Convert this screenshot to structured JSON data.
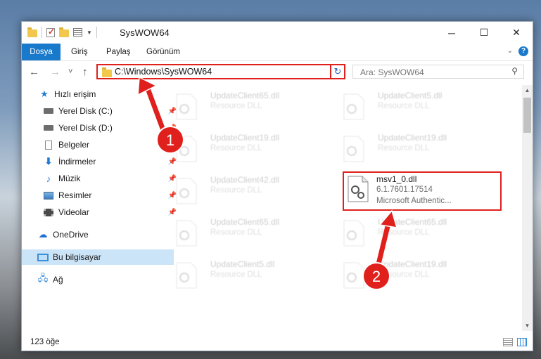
{
  "window": {
    "title": "SysWOW64",
    "controls": {
      "minimize": "─",
      "maximize": "☐",
      "close": "✕"
    }
  },
  "ribbon": {
    "tabs": [
      "Dosya",
      "Giriş",
      "Paylaş",
      "Görünüm"
    ],
    "help": "?"
  },
  "address": {
    "path": "C:\\Windows\\SysWOW64",
    "search_placeholder": "Ara: SysWOW64",
    "back": "←",
    "forward": "→",
    "recent": "˅",
    "up": "↑",
    "refresh": "↻",
    "dropdown": "˅"
  },
  "sidebar": {
    "items": [
      {
        "label": "Hızlı erişim",
        "icon": "star-icon"
      },
      {
        "label": "Yerel Disk (C:)",
        "icon": "drive-icon",
        "pinned": true
      },
      {
        "label": "Yerel Disk (D:)",
        "icon": "drive-icon",
        "pinned": true
      },
      {
        "label": "Belgeler",
        "icon": "documents-icon",
        "pinned": true
      },
      {
        "label": "İndirmeler",
        "icon": "downloads-icon",
        "pinned": true
      },
      {
        "label": "Müzik",
        "icon": "music-icon",
        "pinned": true
      },
      {
        "label": "Resimler",
        "icon": "pictures-icon",
        "pinned": true
      },
      {
        "label": "Videolar",
        "icon": "videos-icon",
        "pinned": true
      },
      {
        "label": "OneDrive",
        "icon": "cloud-icon"
      },
      {
        "label": "Bu bilgisayar",
        "icon": "computer-icon",
        "selected": true
      },
      {
        "label": "Ağ",
        "icon": "network-icon"
      }
    ]
  },
  "files": [
    {
      "name": "UpdateClient65.dll",
      "detail": "Resource DLL"
    },
    {
      "name": "UpdateClient5.dll",
      "detail": "Resource DLL"
    },
    {
      "name": "UpdateClient19.dll",
      "detail": "Resource DLL"
    },
    {
      "name": "UpdateClient19.dll",
      "detail": "Resource DLL"
    },
    {
      "name": "UpdateClient42.dll",
      "detail": "Resource DLL"
    },
    {
      "name": "msv1_0.dll",
      "version": "6.1.7601.17514",
      "detail": "Microsoft Authentic...",
      "highlighted": true
    },
    {
      "name": "UpdateClient65.dll",
      "detail": "Resource DLL"
    },
    {
      "name": "UpdateClient65.dll",
      "detail": "Resource DLL"
    },
    {
      "name": "UpdateClient5.dll",
      "detail": "Resource DLL"
    },
    {
      "name": "UpdateClient19.dll",
      "detail": "Resource DLL"
    }
  ],
  "status": {
    "count": "123 öğe"
  },
  "annotations": {
    "step1": "1",
    "step2": "2",
    "color": "#e0201c"
  }
}
